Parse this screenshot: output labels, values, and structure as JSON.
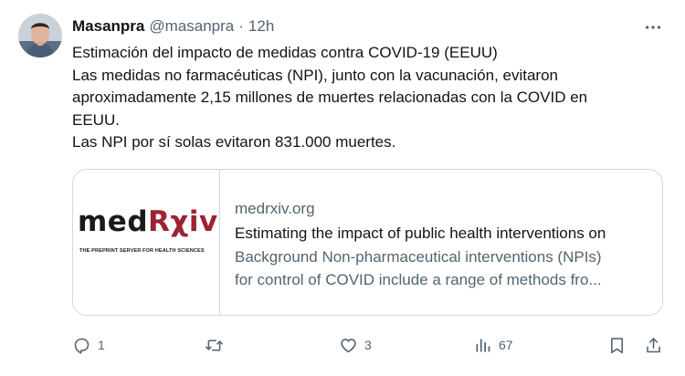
{
  "tweet": {
    "author_name": "Masanpra",
    "handle": "@masanpra",
    "separator": "·",
    "time": "12h",
    "text_lines": [
      "Estimación del impacto de medidas contra COVID-19 (EEUU)",
      "Las medidas no farmacéuticas (NPI), junto con la vacunación, evitaron",
      "aproximadamente 2,15 millones de muertes relacionadas con la COVID en",
      "EEUU.",
      "Las NPI por sí solas evitaron 831.000 muertes."
    ],
    "more_icon": "more-horizontal-icon"
  },
  "card": {
    "logo_med": "med",
    "logo_rxiv": "Rχiv",
    "logo_tagline": "THE PREPRINT SERVER FOR HEALTH SCIENCES",
    "domain": "medrxiv.org",
    "title": "Estimating the impact of public health interventions on",
    "description_lines": [
      "Background Non-pharmaceutical interventions (NPIs)",
      "for control of COVID include a range of methods fro..."
    ]
  },
  "actions": {
    "reply": {
      "icon": "reply-icon",
      "count": "1"
    },
    "retweet": {
      "icon": "retweet-icon",
      "count": ""
    },
    "like": {
      "icon": "heart-icon",
      "count": "3"
    },
    "views": {
      "icon": "views-icon",
      "count": "67"
    },
    "bookmark": {
      "icon": "bookmark-icon"
    },
    "share": {
      "icon": "share-icon"
    }
  },
  "colors": {
    "text_primary": "#0f1419",
    "text_secondary": "#536471",
    "border": "#cfd9de",
    "logo_red": "#9d2235"
  }
}
